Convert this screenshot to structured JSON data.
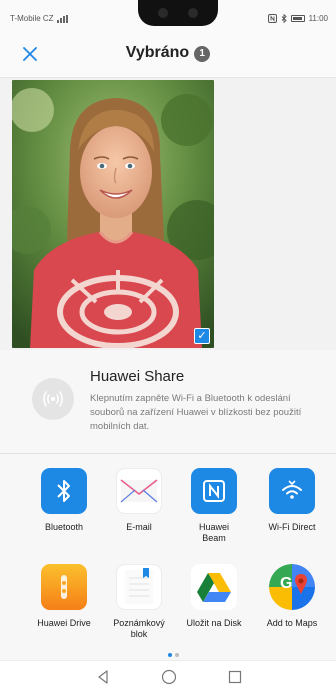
{
  "status_bar": {
    "carrier": "T-Mobile CZ",
    "time": "11:00",
    "icons": [
      "signal-icon",
      "nfc-icon",
      "bluetooth-icon",
      "battery-icon"
    ]
  },
  "header": {
    "title": "Vybráno",
    "selected_count": "1",
    "close_icon": "close-icon",
    "accent_color": "#1e88e5"
  },
  "preview": {
    "checkmark_icon": "checkmark-icon",
    "selected": true
  },
  "huawei_share": {
    "title": "Huawei Share",
    "description": "Klepnutím zapněte Wi-Fi a Bluetooth k odeslání souborů na zařízení Huawei v blízkosti bez použití mobilních dat.",
    "icon": "huawei-share-icon"
  },
  "apps": [
    {
      "label": "Bluetooth",
      "icon": "bluetooth-icon",
      "color": "#1e88e5"
    },
    {
      "label": "E-mail",
      "icon": "email-icon",
      "color": "#ffffff"
    },
    {
      "label": "Huawei Beam",
      "icon": "nfc-icon",
      "color": "#1e88e5"
    },
    {
      "label": "Wi-Fi Direct",
      "icon": "wifi-direct-icon",
      "color": "#1e88e5"
    },
    {
      "label": "Huawei Drive",
      "icon": "huawei-drive-icon",
      "color": "#f9a825"
    },
    {
      "label": "Poznámkový blok",
      "icon": "notepad-icon",
      "color": "#ffffff"
    },
    {
      "label": "Uložit na Disk",
      "icon": "google-drive-icon",
      "color": "#ffffff"
    },
    {
      "label": "Add to Maps",
      "icon": "google-maps-icon",
      "color": "#ffffff"
    }
  ],
  "pager": {
    "pages": 2,
    "current": 1
  },
  "nav_bar": {
    "icons": [
      "back-icon",
      "home-icon",
      "recents-icon"
    ]
  }
}
